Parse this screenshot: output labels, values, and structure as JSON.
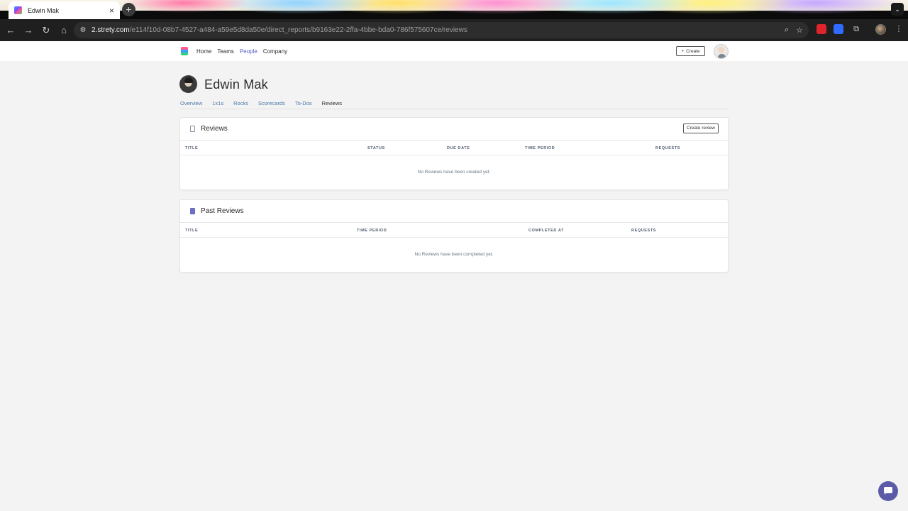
{
  "browser": {
    "tab_title": "Edwin Mak",
    "url_domain": "2.strety.com",
    "url_path": "/e114f10d-08b7-4527-a484-a59e5d8da50e/direct_reports/b9163e22-2ffa-4bbe-bda0-786f575607ce/reviews"
  },
  "topnav": {
    "items": [
      "Home",
      "Teams",
      "People",
      "Company"
    ],
    "active": "People",
    "create_label": "Create"
  },
  "profile": {
    "name": "Edwin Mak",
    "tabs": [
      "Overview",
      "1x1s",
      "Rocks",
      "Scorecards",
      "To-Dos",
      "Reviews"
    ],
    "active_tab": "Reviews"
  },
  "reviews": {
    "title": "Reviews",
    "action_label": "Create review",
    "columns": [
      "TITLE",
      "STATUS",
      "DUE DATE",
      "TIME PERIOD",
      "REQUESTS"
    ],
    "empty_text": "No Reviews have been created yet."
  },
  "past_reviews": {
    "title": "Past Reviews",
    "columns": [
      "TITLE",
      "TIME PERIOD",
      "COMPLETED AT",
      "REQUESTS"
    ],
    "empty_text": "No Reviews have been completed yet."
  },
  "colors": {
    "accent": "#5b5cc8",
    "chat_bubble": "#5b5ba8",
    "page_background": "#f3f3f3"
  }
}
